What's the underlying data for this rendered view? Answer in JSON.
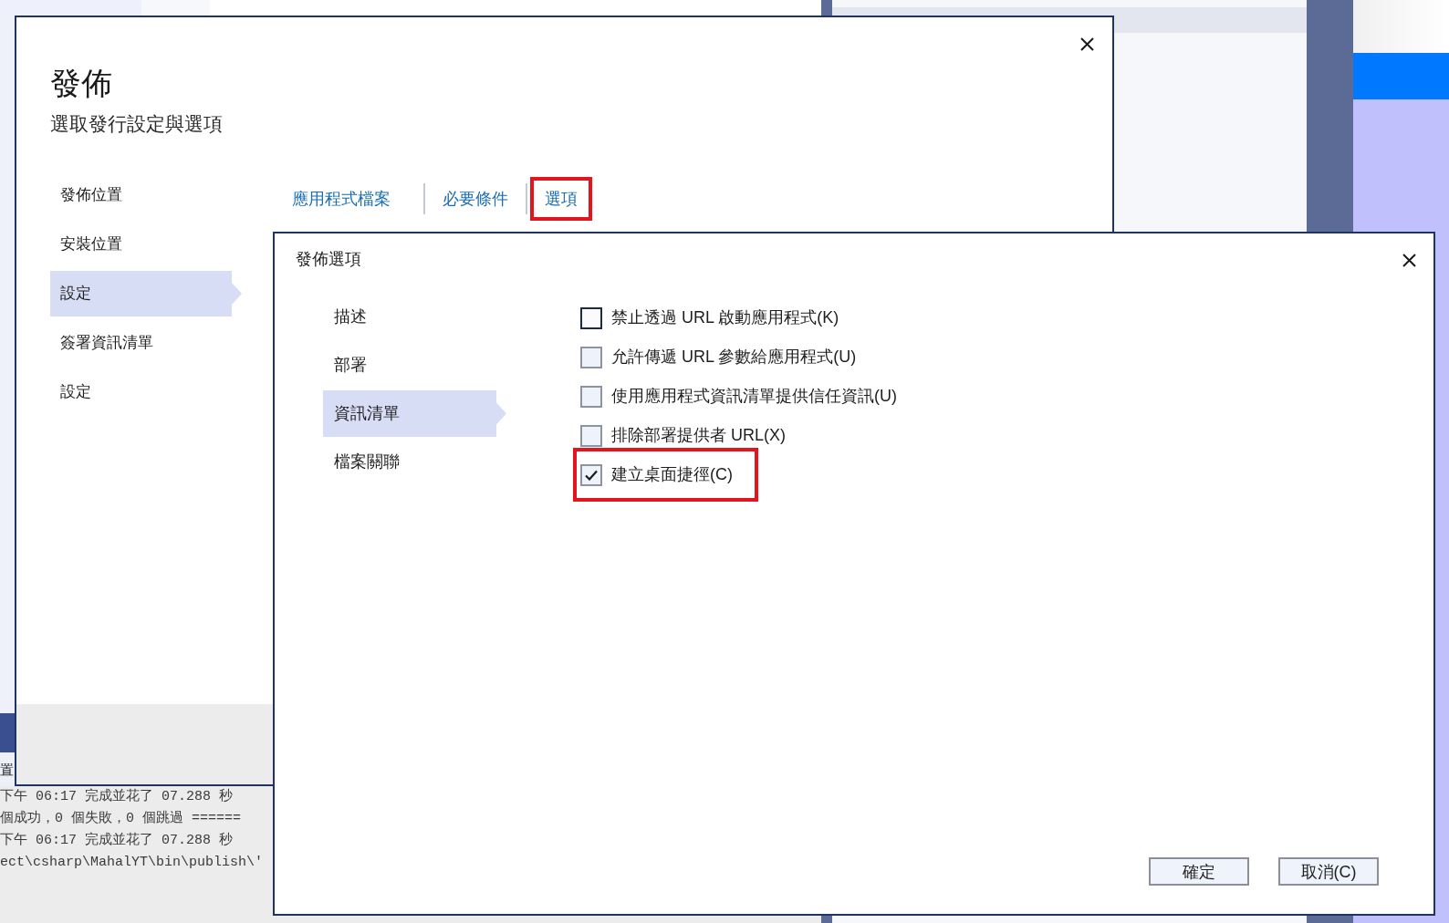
{
  "output_panel": {
    "tab_label": "置",
    "lines": [
      "下午 06:17 完成並花了 07.288 秒",
      "個成功，0 個失敗，0 個跳過 ======",
      "下午 06:17 完成並花了 07.288 秒",
      "ect\\csharp\\MahalYT\\bin\\publish\\'"
    ]
  },
  "publish_dialog": {
    "title": "發佈",
    "subtitle": "選取發行設定與選項",
    "nav_items": [
      {
        "label": "發佈位置",
        "selected": false
      },
      {
        "label": "安裝位置",
        "selected": false
      },
      {
        "label": "設定",
        "selected": true
      },
      {
        "label": "簽署資訊清單",
        "selected": false
      },
      {
        "label": "設定",
        "selected": false
      }
    ],
    "action_links": [
      {
        "label": "應用程式檔案",
        "highlighted": false
      },
      {
        "label": "必要條件",
        "highlighted": false
      },
      {
        "label": "選項",
        "highlighted": true
      }
    ]
  },
  "options_dialog": {
    "title": "發佈選項",
    "nav_items": [
      {
        "label": "描述",
        "selected": false
      },
      {
        "label": "部署",
        "selected": false
      },
      {
        "label": "資訊清單",
        "selected": true
      },
      {
        "label": "檔案關聯",
        "selected": false
      }
    ],
    "options": [
      {
        "label": "禁止透過 URL 啟動應用程式(K)",
        "checked": false,
        "focused": true,
        "highlighted": false
      },
      {
        "label": "允許傳遞 URL 參數給應用程式(U)",
        "checked": false,
        "focused": false,
        "highlighted": false
      },
      {
        "label": "使用應用程式資訊清單提供信任資訊(U)",
        "checked": false,
        "focused": false,
        "highlighted": false
      },
      {
        "label": "排除部署提供者 URL(X)",
        "checked": false,
        "focused": false,
        "highlighted": false
      },
      {
        "label": "建立桌面捷徑(C)",
        "checked": true,
        "focused": false,
        "highlighted": true
      }
    ],
    "buttons": [
      "確定",
      "取消(C)"
    ]
  }
}
